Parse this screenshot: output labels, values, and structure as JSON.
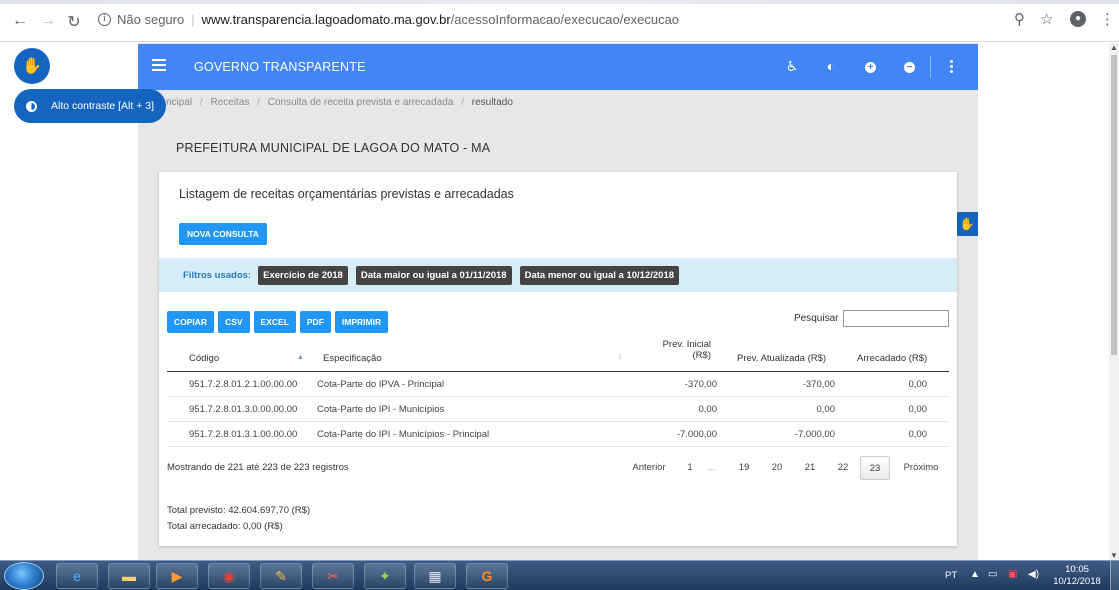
{
  "browser": {
    "security_label": "Não seguro",
    "url_host": "www.transparencia.lagoadomato.ma.gov.br",
    "url_path": "/acessoInformacao/execucao/execucao",
    "icons": [
      "back-icon",
      "forward-icon",
      "reload-icon",
      "info-icon",
      "zoom-icon",
      "star-icon",
      "profile-icon"
    ]
  },
  "header": {
    "title": "GOVERNO TRANSPARENTE",
    "icons": [
      "menu-icon",
      "accessibility-icon",
      "contrast-icon",
      "zoom-in-icon",
      "zoom-out-icon",
      "more-icon"
    ],
    "color": "#4285f4"
  },
  "accessibility": {
    "contrast_label": "Alto contraste [Alt + 3]",
    "color": "#1565c0"
  },
  "breadcrumb": {
    "items": [
      "ncipal",
      "Receitas",
      "Consulta de receita prevista e arrecadada",
      "resultado"
    ]
  },
  "org_title": "PREFEITURA MUNICIPAL DE LAGOA DO MATO - MA",
  "card": {
    "title": "Listagem de receitas orçamentárias previstas e arrecadadas",
    "new_query_label": "NOVA CONSULTA",
    "filters_label": "Filtros usados:",
    "filters": [
      "Exercício de 2018",
      "Data maior ou igual a 01/11/2018",
      "Data menor ou igual a 10/12/2018"
    ]
  },
  "toolbar": {
    "export_buttons": [
      "COPIAR",
      "CSV",
      "EXCEL",
      "PDF",
      "IMPRIMIR"
    ],
    "search_label": "Pesquisar",
    "search_value": ""
  },
  "table": {
    "headers": {
      "codigo": "Código",
      "especificacao": "Especificação",
      "prev_inicial_1": "Prev. Inicial",
      "prev_inicial_2": "(R$)",
      "prev_atualizada": "Prev. Atualizada (R$)",
      "arrecadado": "Arrecadado (R$)"
    },
    "rows": [
      {
        "codigo": "951.7.2.8.01.2.1.00.00.00",
        "especificacao": "Cota-Parte do IPVA - Principal",
        "prev_inicial": "-370,00",
        "prev_atualizada": "-370,00",
        "arrecadado": "0,00"
      },
      {
        "codigo": "951.7.2.8.01.3.0.00.00.00",
        "especificacao": "Cota-Parte do IPI - Municípios",
        "prev_inicial": "0,00",
        "prev_atualizada": "0,00",
        "arrecadado": "0,00"
      },
      {
        "codigo": "951.7.2.8.01.3.1.00.00.00",
        "especificacao": "Cota-Parte do IPI - Municípios - Principal",
        "prev_inicial": "-7.000,00",
        "prev_atualizada": "-7.000,00",
        "arrecadado": "0,00"
      }
    ]
  },
  "pagination": {
    "info": "Mostrando de 221 até 223 de 223 registros",
    "previous": "Anterior",
    "pages": [
      "1",
      "...",
      "19",
      "20",
      "21",
      "22",
      "23"
    ],
    "current": "23",
    "next": "Próximo"
  },
  "totals": {
    "previsto": "Total previsto: 42.604.697,70 (R$)",
    "arrecadado": "Total arrecadado: 0,00 (R$)"
  },
  "taskbar": {
    "language": "PT",
    "time": "10:05",
    "date": "10/12/2018",
    "apps": [
      "start-icon",
      "ie-icon",
      "folder-icon",
      "media-player-icon",
      "chrome-icon",
      "paint-icon",
      "snipping-icon",
      "app-icon",
      "calculator-icon",
      "pdf-icon"
    ]
  }
}
